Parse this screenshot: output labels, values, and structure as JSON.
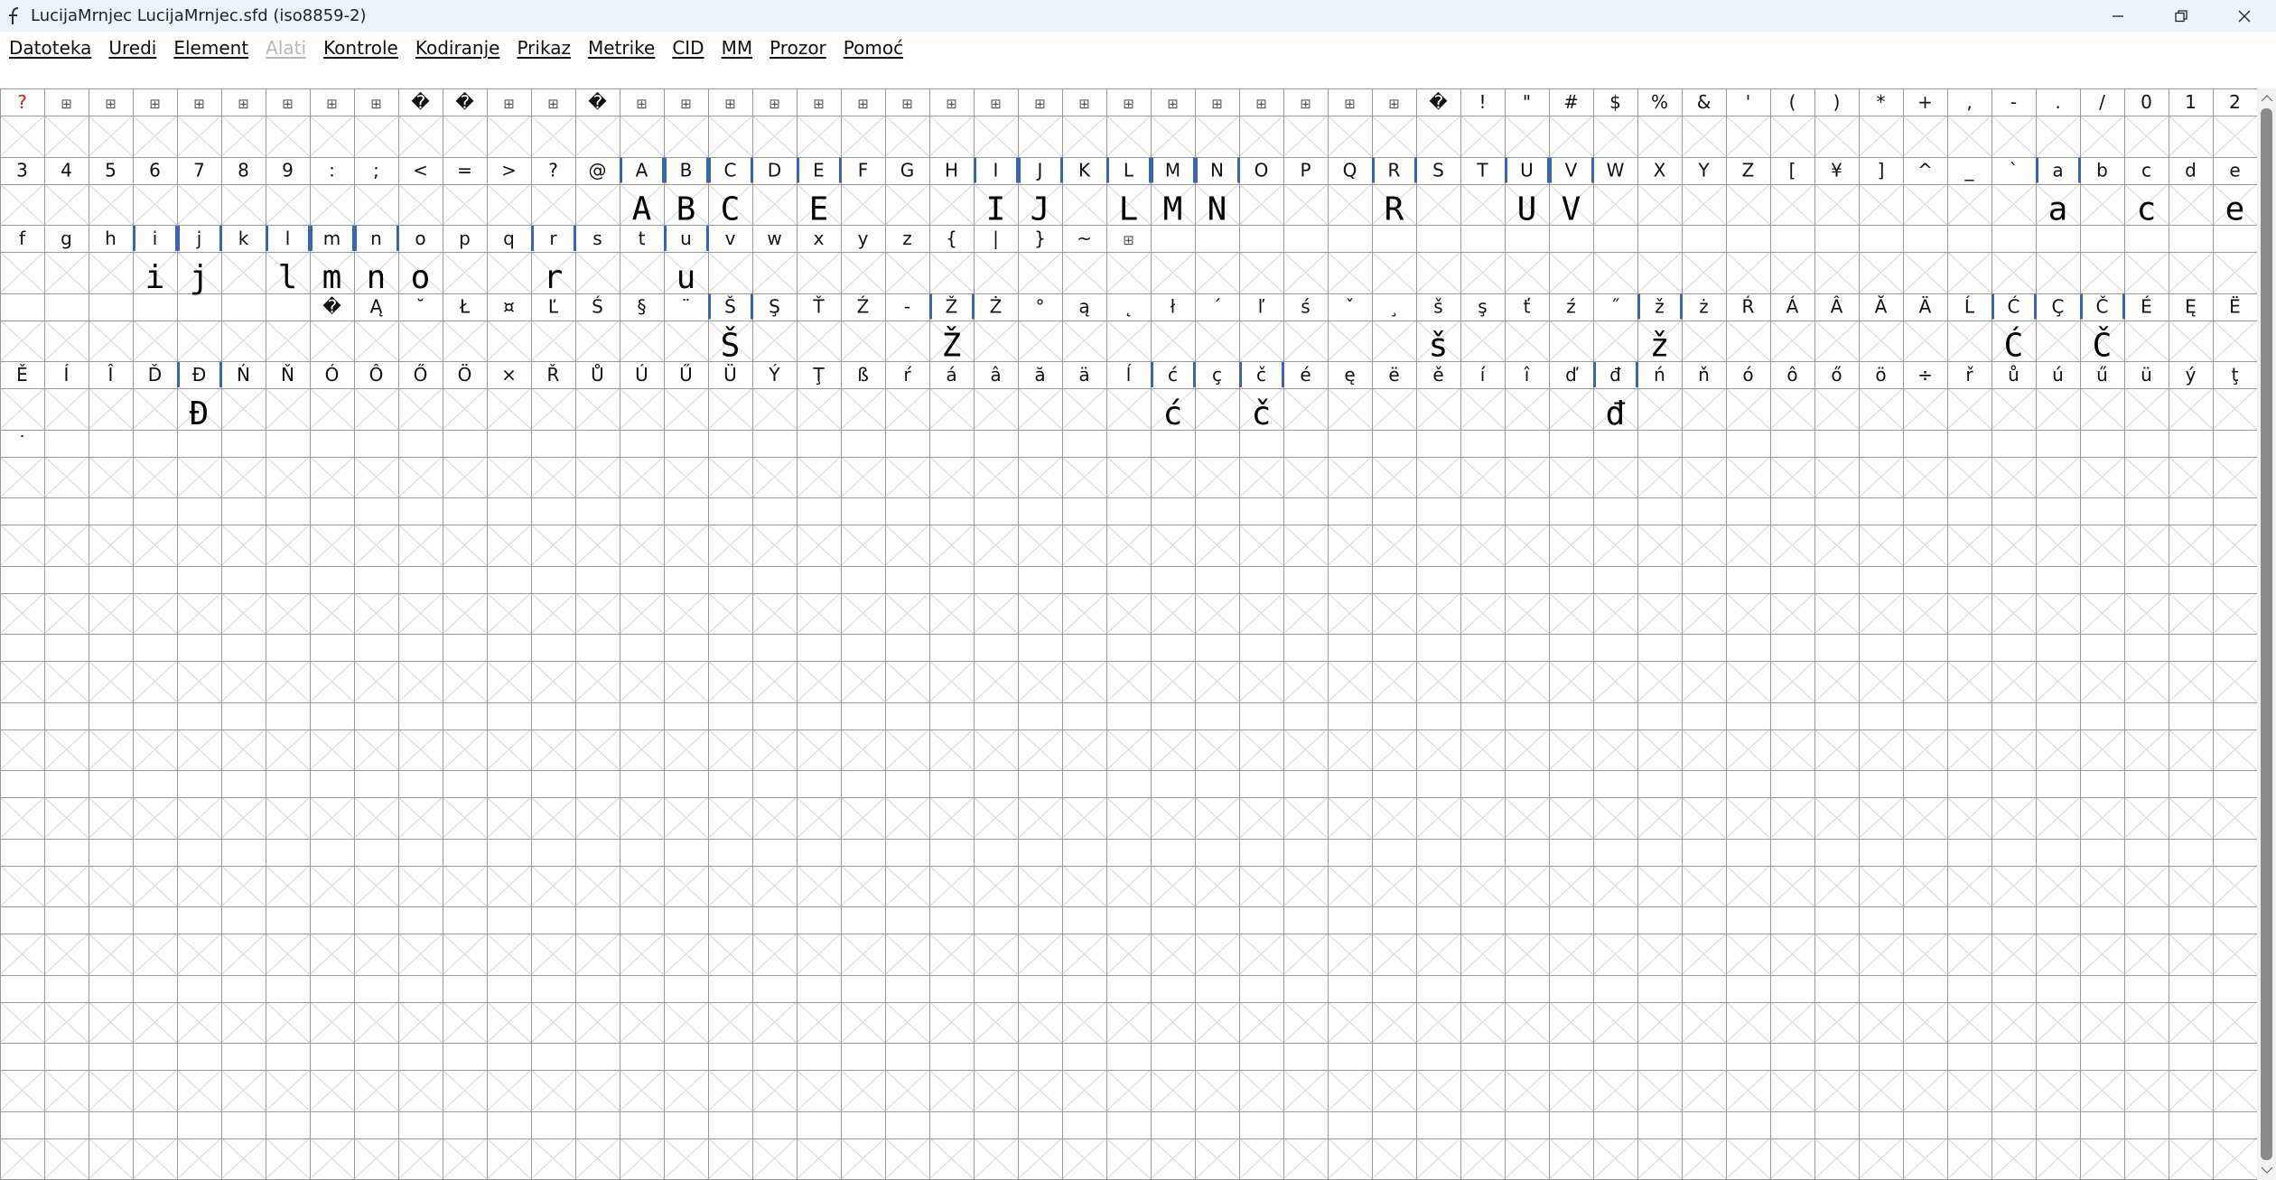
{
  "window": {
    "title": "LucijaMrnjec  LucijaMrnjec.sfd (iso8859-2)",
    "app_icon": "fontforge-icon",
    "controls": [
      "minimize-icon",
      "restore-icon",
      "close-icon"
    ]
  },
  "menu": [
    {
      "label": "Datoteka",
      "enabled": true
    },
    {
      "label": "Uredi",
      "enabled": true
    },
    {
      "label": "Element",
      "enabled": true
    },
    {
      "label": "Alati",
      "enabled": false
    },
    {
      "label": "Kontrole",
      "enabled": true
    },
    {
      "label": "Kodiranje",
      "enabled": true
    },
    {
      "label": "Prikaz",
      "enabled": true
    },
    {
      "label": "Metrike",
      "enabled": true
    },
    {
      "label": "CID",
      "enabled": true
    },
    {
      "label": "MM",
      "enabled": true
    },
    {
      "label": "Prozor",
      "enabled": true
    },
    {
      "label": "Pomoć",
      "enabled": true
    }
  ],
  "glyph_grid": {
    "columns": 51,
    "total_rows": 16,
    "colors": {
      "line": "#9a9a9a",
      "diagonal": "#d6d6d6",
      "worked_marker": "#3a66b0",
      "missing_label": "#d02020",
      "glyph": "#000000"
    },
    "rows": [
      {
        "labels": [
          "?",
          "⊞",
          "⊞",
          "⊞",
          "⊞",
          "⊞",
          "⊞",
          "⊞",
          "⊞",
          "�",
          "�",
          "⊞",
          "⊞",
          "�",
          "⊞",
          "⊞",
          "⊞",
          "⊞",
          "⊞",
          "⊞",
          "⊞",
          "⊞",
          "⊞",
          "⊞",
          "⊞",
          "⊞",
          "⊞",
          "⊞",
          "⊞",
          "⊞",
          "⊞",
          "⊞",
          "�",
          "!",
          "\"",
          "#",
          "$",
          "%",
          "&",
          "'",
          "(",
          ")",
          "*",
          "+",
          ",",
          "-",
          ".",
          "/",
          "0",
          "1",
          "2"
        ],
        "glyphs": [],
        "worked": []
      },
      {
        "labels": [
          "3",
          "4",
          "5",
          "6",
          "7",
          "8",
          "9",
          ":",
          ";",
          "<",
          "=",
          ">",
          "?",
          "@",
          "A",
          "B",
          "C",
          "D",
          "E",
          "F",
          "G",
          "H",
          "I",
          "J",
          "K",
          "L",
          "M",
          "N",
          "O",
          "P",
          "Q",
          "R",
          "S",
          "T",
          "U",
          "V",
          "W",
          "X",
          "Y",
          "Z",
          "[",
          "¥",
          "]",
          "^",
          "_",
          "`",
          "a",
          "b",
          "c",
          "d",
          "e"
        ],
        "glyphs": [
          {
            "col": 14,
            "text": "A"
          },
          {
            "col": 15,
            "text": "B"
          },
          {
            "col": 16,
            "text": "C"
          },
          {
            "col": 18,
            "text": "E"
          },
          {
            "col": 22,
            "text": "I"
          },
          {
            "col": 23,
            "text": "J"
          },
          {
            "col": 25,
            "text": "L"
          },
          {
            "col": 26,
            "text": "M"
          },
          {
            "col": 27,
            "text": "N"
          },
          {
            "col": 31,
            "text": "R"
          },
          {
            "col": 34,
            "text": "U"
          },
          {
            "col": 35,
            "text": "V"
          },
          {
            "col": 46,
            "text": "a"
          },
          {
            "col": 48,
            "text": "c"
          },
          {
            "col": 50,
            "text": "e"
          }
        ],
        "worked": [
          14,
          15,
          16,
          18,
          22,
          23,
          25,
          26,
          27,
          31,
          34,
          35,
          46
        ]
      },
      {
        "labels": [
          "f",
          "g",
          "h",
          "i",
          "j",
          "k",
          "l",
          "m",
          "n",
          "o",
          "p",
          "q",
          "r",
          "s",
          "t",
          "u",
          "v",
          "w",
          "x",
          "y",
          "z",
          "{",
          "|",
          "}",
          "~",
          "⊞"
        ],
        "glyphs": [
          {
            "col": 3,
            "text": "i"
          },
          {
            "col": 4,
            "text": "j"
          },
          {
            "col": 6,
            "text": "l"
          },
          {
            "col": 7,
            "text": "m"
          },
          {
            "col": 8,
            "text": "n"
          },
          {
            "col": 9,
            "text": "o"
          },
          {
            "col": 12,
            "text": "r"
          },
          {
            "col": 15,
            "text": "u"
          }
        ],
        "worked": [
          3,
          4,
          6,
          7,
          8,
          12,
          15
        ]
      },
      {
        "labels": [
          "",
          "",
          "",
          "",
          "",
          "",
          "",
          "�",
          "Ą",
          "˘",
          "Ł",
          "¤",
          "Ľ",
          "Ś",
          "§",
          "¨",
          "Š",
          "Ş",
          "Ť",
          "Ź",
          "-",
          "Ž",
          "Ż",
          "°",
          "ą",
          "˛",
          "ł",
          "´",
          "ľ",
          "ś",
          "ˇ",
          "¸",
          "š",
          "ş",
          "ť",
          "ź",
          "˝",
          "ž",
          "ż",
          "Ŕ",
          "Á",
          "Â",
          "Ă",
          "Ä",
          "Ĺ",
          "Ć",
          "Ç",
          "Č",
          "É",
          "Ę",
          "Ë"
        ],
        "glyphs": [
          {
            "col": 16,
            "text": "Š"
          },
          {
            "col": 21,
            "text": "Ž"
          },
          {
            "col": 32,
            "text": "š"
          },
          {
            "col": 37,
            "text": "ž"
          },
          {
            "col": 45,
            "text": "Ć"
          },
          {
            "col": 47,
            "text": "Č"
          }
        ],
        "worked": [
          16,
          21,
          37,
          45,
          47
        ]
      },
      {
        "labels": [
          "Ě",
          "Í",
          "Î",
          "Ď",
          "Đ",
          "Ń",
          "Ň",
          "Ó",
          "Ô",
          "Ő",
          "Ö",
          "×",
          "Ř",
          "Ů",
          "Ú",
          "Ű",
          "Ü",
          "Ý",
          "Ţ",
          "ß",
          "ŕ",
          "á",
          "â",
          "ă",
          "ä",
          "ĺ",
          "ć",
          "ç",
          "č",
          "é",
          "ę",
          "ë",
          "ě",
          "í",
          "î",
          "ď",
          "đ",
          "ń",
          "ň",
          "ó",
          "ô",
          "ő",
          "ö",
          "÷",
          "ř",
          "ů",
          "ú",
          "ű",
          "ü",
          "ý",
          "ţ"
        ],
        "glyphs": [
          {
            "col": 4,
            "text": "Đ"
          },
          {
            "col": 26,
            "text": "ć"
          },
          {
            "col": 28,
            "text": "č"
          },
          {
            "col": 36,
            "text": "đ"
          }
        ],
        "worked": [
          4,
          26,
          28,
          36
        ]
      },
      {
        "labels": [
          "˙"
        ],
        "glyphs": [],
        "worked": []
      }
    ]
  },
  "scrollbar": {
    "up_icon": "scroll-up-arrow-icon",
    "down_icon": "scroll-down-arrow-icon"
  }
}
